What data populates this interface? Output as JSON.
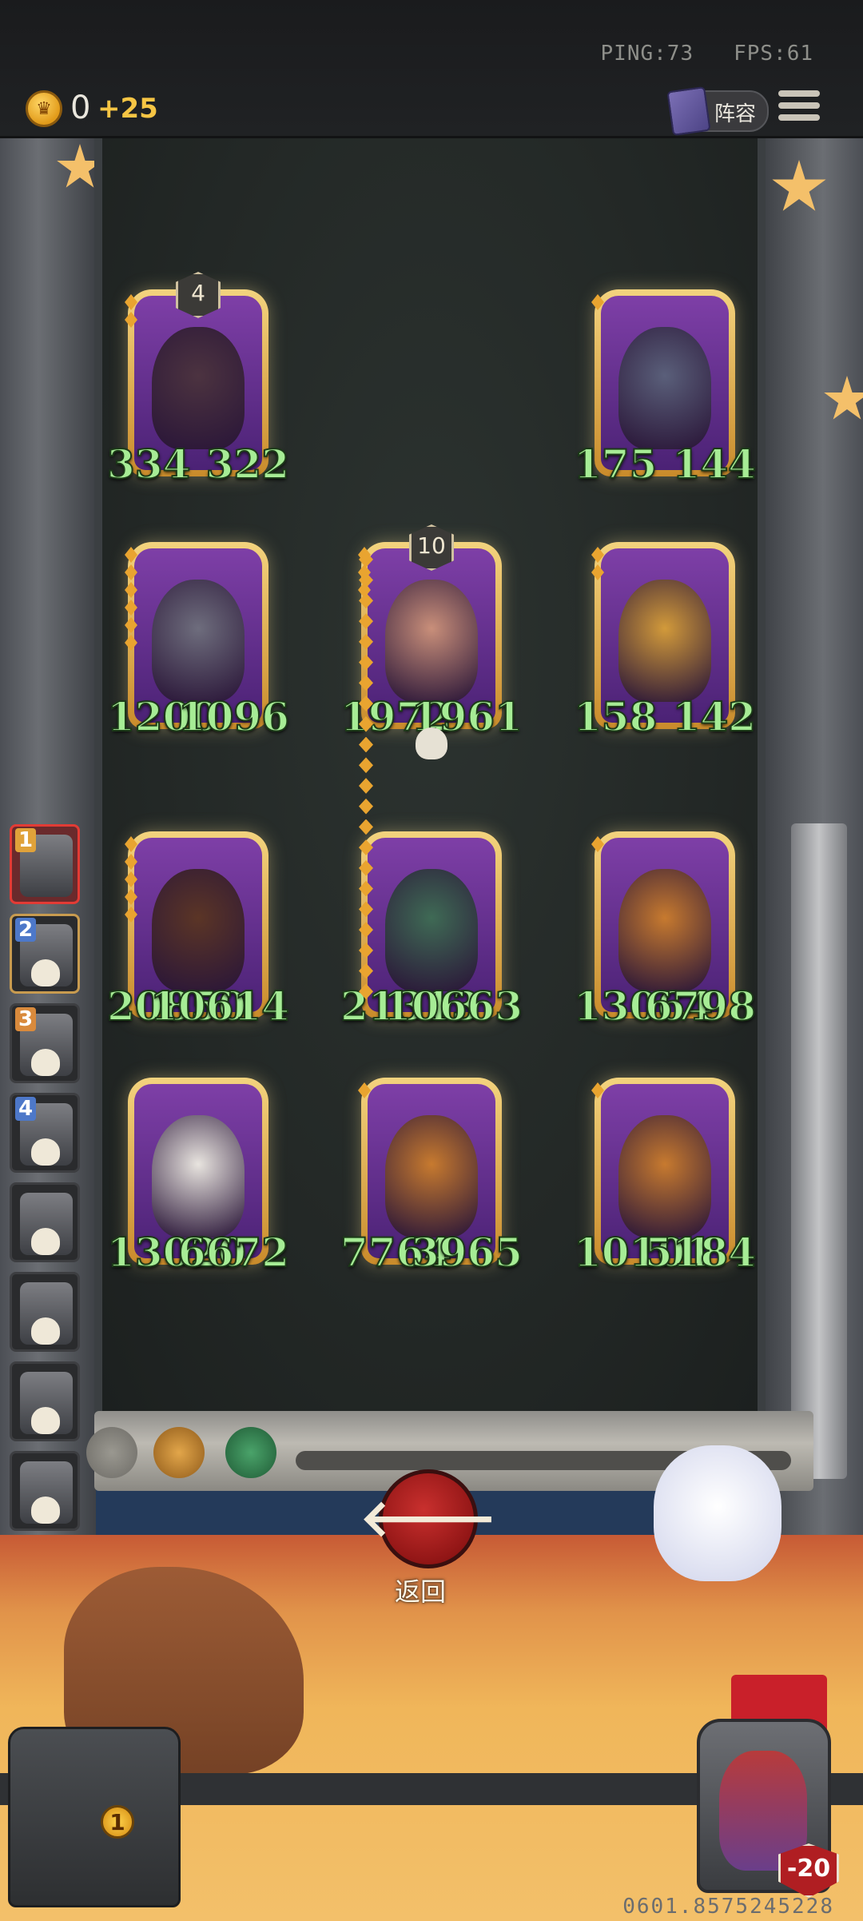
{
  "hud": {
    "ping_label": "PING:73",
    "fps_label": "FPS:61",
    "gold_amount": "0",
    "gold_income": "+25",
    "lineup_label": "阵容"
  },
  "board": {
    "cards": [
      {
        "name": "armored-knight",
        "tier": "4",
        "attack": "334",
        "health": "322",
        "gems": 2,
        "color": "#4c3340"
      },
      {
        "name": "bat-demon",
        "tier": "",
        "attack": "175",
        "health": "144",
        "gems": 1,
        "color": "#5a5f7a"
      },
      {
        "name": "dragon",
        "tier": "",
        "attack": "1200",
        "health": "1096",
        "gems": 6,
        "color": "#6e6d7d"
      },
      {
        "name": "old-scientist",
        "tier": "10",
        "attack": "1972",
        "health": "1961",
        "gems": 3,
        "color": "#c98f7a"
      },
      {
        "name": "golden-mummy",
        "tier": "",
        "attack": "158",
        "health": "142",
        "gems": 2,
        "color": "#d29a3a"
      },
      {
        "name": "horned-beast",
        "tier": "",
        "attack": "20850",
        "health": "10614",
        "gems": 5,
        "color": "#5b3526"
      },
      {
        "name": "green-demon-girl",
        "tier": "",
        "attack": "21313",
        "health": "10663",
        "gems": 0,
        "color": "#3f6a55"
      },
      {
        "name": "raccoon-juggler",
        "tier": "",
        "attack": "13064",
        "health": "6798",
        "gems": 1,
        "color": "#c77a2f"
      },
      {
        "name": "bulldog",
        "tier": "",
        "attack": "13020",
        "health": "6672",
        "gems": 0,
        "color": "#e8e4df"
      },
      {
        "name": "raccoon-juggler-2",
        "tier": "",
        "attack": "7764",
        "health": "3965",
        "gems": 1,
        "color": "#c77a2f"
      },
      {
        "name": "raccoon-juggler-3",
        "tier": "",
        "attack": "10101",
        "health": "5184",
        "gems": 1,
        "color": "#c77a2f"
      }
    ]
  },
  "roster": {
    "items": [
      {
        "label": "1",
        "state": "active"
      },
      {
        "label": "2",
        "state": "selected"
      },
      {
        "label": "3",
        "state": "eliminated"
      },
      {
        "label": "4",
        "state": "eliminated"
      },
      {
        "label": "",
        "state": "eliminated"
      },
      {
        "label": "",
        "state": "eliminated"
      },
      {
        "label": "",
        "state": "eliminated"
      },
      {
        "label": "",
        "state": "eliminated"
      }
    ]
  },
  "controls": {
    "back_label": "返回",
    "chest_count": "1",
    "hero_health": "-20"
  },
  "footer": {
    "build_id": "0601.8575245228"
  }
}
